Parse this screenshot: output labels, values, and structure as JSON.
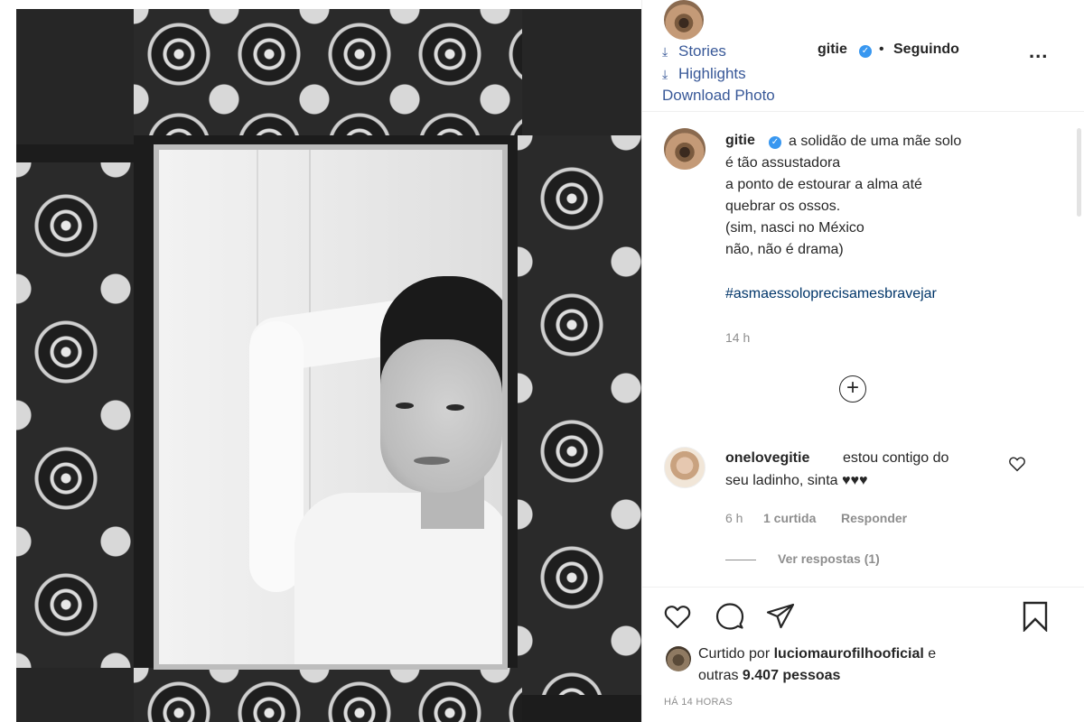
{
  "header": {
    "username": "gitie",
    "separator": "•",
    "follow_status": "Seguindo",
    "more_label": "..."
  },
  "downloader": {
    "stories_label": "Stories",
    "highlights_label": "Highlights",
    "photo_label": "Download Photo"
  },
  "caption": {
    "username": "gitie",
    "line1": "a solidão de uma mãe solo",
    "line2": "é tão assustadora",
    "line3": "a ponto de estourar a alma até",
    "line4": "quebrar os ossos.",
    "line5": "(sim, nasci no México",
    "line6": "não, não é drama)",
    "hashtag": "#asmaessoloprecisamesbravejar",
    "time": "14 h"
  },
  "load_more": {
    "symbol": "+"
  },
  "comment": {
    "username": "onelovegitie",
    "text_part1": "estou contigo do",
    "text_part2": "seu ladinho, sinta ♥♥♥",
    "time": "6 h",
    "likes": "1 curtida",
    "reply_label": "Responder",
    "view_replies": "Ver respostas (1)"
  },
  "likes": {
    "prefix": "Curtido por ",
    "user": "luciomaurofilhooficial",
    "suffix": " e",
    "others_prefix": "outras ",
    "others_count": "9.407 pessoas"
  },
  "post_time": "HÁ 14 HORAS",
  "icons": {
    "verified": "verified-badge",
    "download": "download-icon",
    "like": "heart-outline-icon",
    "comment": "comment-bubble-icon",
    "share": "paper-plane-icon",
    "save": "bookmark-icon"
  },
  "colors": {
    "link_blue": "#385898",
    "hashtag": "#003569",
    "verified": "#3897f0",
    "muted": "#8e8e8e",
    "text": "#262626"
  }
}
